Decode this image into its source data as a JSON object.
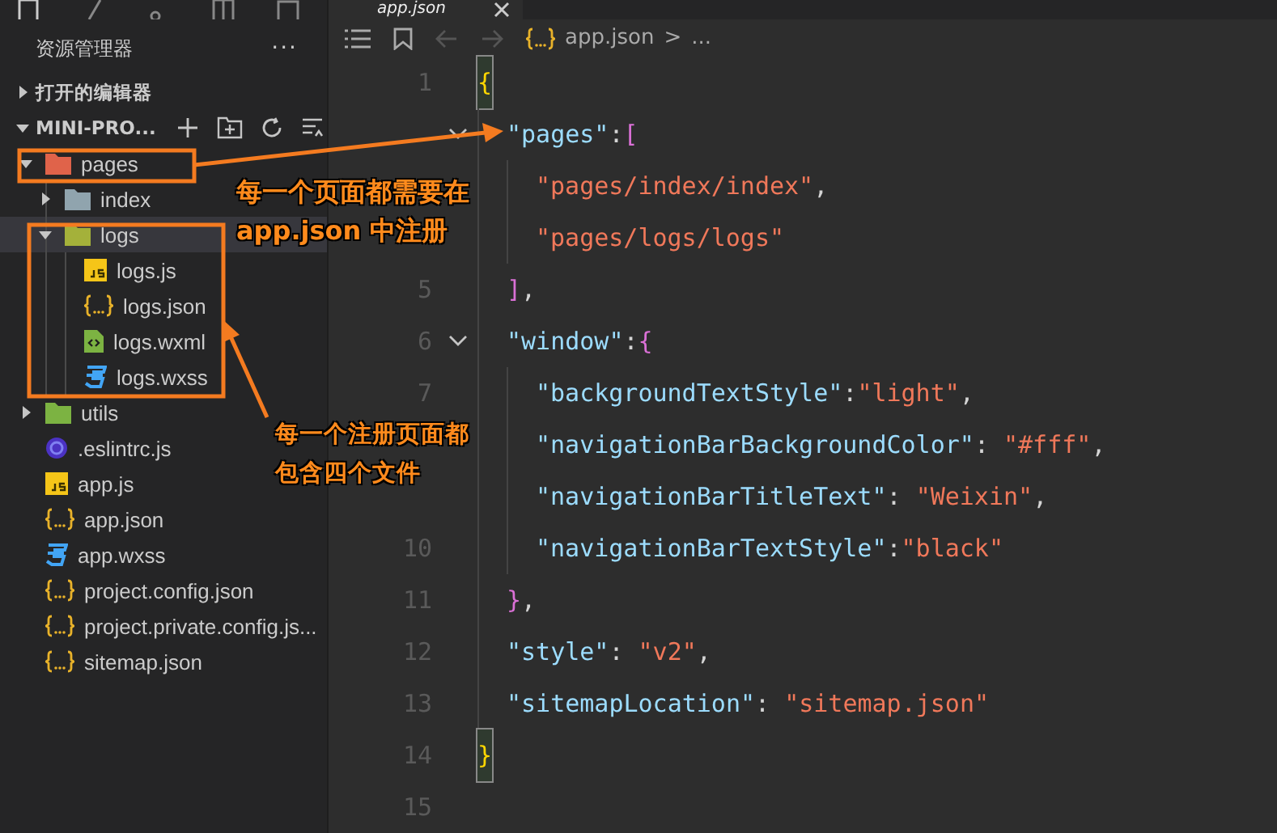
{
  "tab": {
    "label": "app.json"
  },
  "sidebar": {
    "title": "资源管理器",
    "more": "···",
    "open_editors": {
      "label": "打开的编辑器",
      "expanded": false
    },
    "project": {
      "label": "MINI-PRO...",
      "expanded": true
    },
    "tree": [
      {
        "kind": "folder",
        "color": "#e0634a",
        "label": "pages",
        "expanded": true,
        "selected": false,
        "children": [
          {
            "kind": "folder",
            "color": "#90a4ae",
            "label": "index",
            "expanded": false,
            "selected": false
          },
          {
            "kind": "folder",
            "color": "#a4b13a",
            "label": "logs",
            "expanded": true,
            "selected": true,
            "children": [
              {
                "kind": "js",
                "label": "logs.js",
                "selected": false
              },
              {
                "kind": "json",
                "label": "logs.json",
                "selected": false
              },
              {
                "kind": "wxml",
                "label": "logs.wxml",
                "selected": false
              },
              {
                "kind": "wxss",
                "label": "logs.wxss",
                "selected": false
              }
            ]
          }
        ]
      },
      {
        "kind": "folder",
        "color": "#7cb342",
        "label": "utils",
        "expanded": false,
        "selected": false
      },
      {
        "kind": "eslint",
        "label": ".eslintrc.js",
        "selected": false
      },
      {
        "kind": "js",
        "label": "app.js",
        "selected": false
      },
      {
        "kind": "json",
        "label": "app.json",
        "selected": false
      },
      {
        "kind": "wxss",
        "label": "app.wxss",
        "selected": false
      },
      {
        "kind": "json",
        "label": "project.config.json",
        "selected": false
      },
      {
        "kind": "json",
        "label": "project.private.config.js...",
        "selected": false
      },
      {
        "kind": "json",
        "label": "sitemap.json",
        "selected": false
      }
    ]
  },
  "breadcrumb": {
    "file": "app.json",
    "separator": ">",
    "rest": "..."
  },
  "code": [
    {
      "number": "1",
      "foldable": false,
      "matched": true,
      "tokens": [
        {
          "kind": "bracket",
          "text": "{"
        }
      ],
      "children": [
        {
          "foldable": true,
          "tokens": [
            {
              "kind": "key",
              "text": "\"pages\""
            },
            {
              "kind": "punct",
              "text": ":"
            },
            {
              "kind": "bracket",
              "text": "["
            }
          ],
          "children": [
            {
              "foldable": false,
              "tokens": [
                {
                  "kind": "string",
                  "text": "\"pages/index/index\""
                },
                {
                  "kind": "punct",
                  "text": ","
                }
              ]
            },
            {
              "foldable": false,
              "tokens": [
                {
                  "kind": "string",
                  "text": "\"pages/logs/logs\""
                }
              ]
            }
          ]
        },
        {
          "number": "5",
          "foldable": false,
          "tokens": [
            {
              "kind": "bracket",
              "text": "]"
            },
            {
              "kind": "punct",
              "text": ","
            }
          ]
        },
        {
          "number": "6",
          "foldable": true,
          "tokens": [
            {
              "kind": "key",
              "text": "\"window\""
            },
            {
              "kind": "punct",
              "text": ":"
            },
            {
              "kind": "bracket",
              "text": "{"
            }
          ],
          "children": [
            {
              "number": "7",
              "foldable": false,
              "tokens": [
                {
                  "kind": "key",
                  "text": "\"backgroundTextStyle\""
                },
                {
                  "kind": "punct",
                  "text": ":"
                },
                {
                  "kind": "string",
                  "text": "\"light\""
                },
                {
                  "kind": "punct",
                  "text": ","
                }
              ]
            },
            {
              "foldable": false,
              "tokens": [
                {
                  "kind": "key",
                  "text": "\"navigationBarBackgroundColor\""
                },
                {
                  "kind": "punct",
                  "text": ": "
                },
                {
                  "kind": "string",
                  "text": "\"#fff\""
                },
                {
                  "kind": "punct",
                  "text": ","
                }
              ]
            },
            {
              "foldable": false,
              "tokens": [
                {
                  "kind": "key",
                  "text": "\"navigationBarTitleText\""
                },
                {
                  "kind": "punct",
                  "text": ": "
                },
                {
                  "kind": "string",
                  "text": "\"Weixin\""
                },
                {
                  "kind": "punct",
                  "text": ","
                }
              ]
            },
            {
              "number": "10",
              "foldable": false,
              "tokens": [
                {
                  "kind": "key",
                  "text": "\"navigationBarTextStyle\""
                },
                {
                  "kind": "punct",
                  "text": ":"
                },
                {
                  "kind": "string",
                  "text": "\"black\""
                }
              ]
            }
          ]
        },
        {
          "number": "11",
          "foldable": false,
          "tokens": [
            {
              "kind": "bracket",
              "text": "}"
            },
            {
              "kind": "punct",
              "text": ","
            }
          ]
        },
        {
          "number": "12",
          "foldable": false,
          "tokens": [
            {
              "kind": "key",
              "text": "\"style\""
            },
            {
              "kind": "punct",
              "text": ": "
            },
            {
              "kind": "string",
              "text": "\"v2\""
            },
            {
              "kind": "punct",
              "text": ","
            }
          ]
        },
        {
          "number": "13",
          "foldable": false,
          "tokens": [
            {
              "kind": "key",
              "text": "\"sitemapLocation\""
            },
            {
              "kind": "punct",
              "text": ": "
            },
            {
              "kind": "string",
              "text": "\"sitemap.json\""
            }
          ]
        }
      ]
    },
    {
      "number": "14",
      "foldable": false,
      "matched": true,
      "tokens": [
        {
          "kind": "bracket",
          "text": "}"
        }
      ]
    },
    {
      "number": "15",
      "foldable": false
    }
  ],
  "annotations": [
    {
      "lines": [
        "每一个页面都需要在",
        "app.json 中注册"
      ]
    },
    {
      "lines": [
        "每一个注册页面都",
        "包含四个文件"
      ]
    }
  ]
}
